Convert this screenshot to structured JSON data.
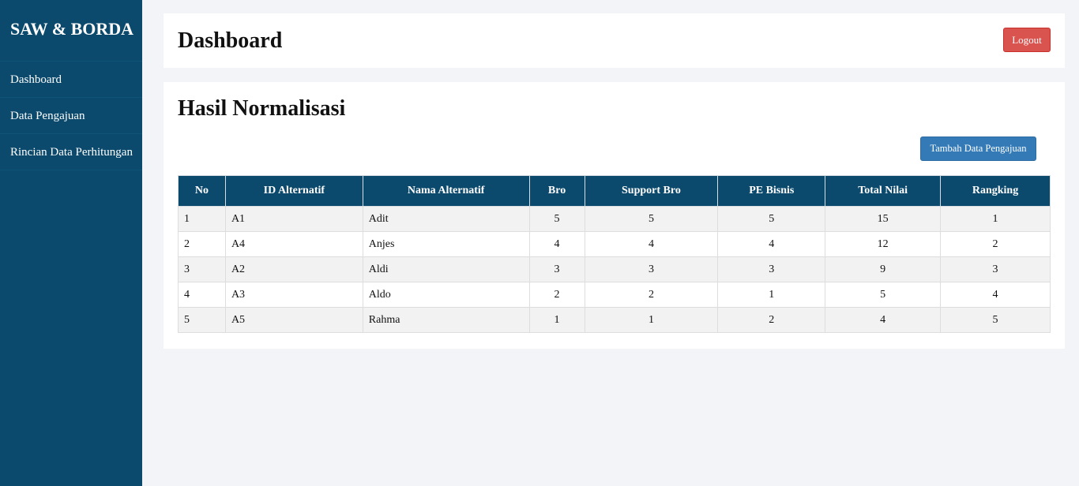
{
  "app": {
    "brand": "SAW & BORDA"
  },
  "sidebar": {
    "items": [
      {
        "label": "Dashboard"
      },
      {
        "label": "Data Pengajuan"
      },
      {
        "label": "Rincian Data Perhitungan"
      }
    ]
  },
  "header": {
    "title": "Dashboard",
    "logout_label": "Logout"
  },
  "main": {
    "title": "Hasil Normalisasi",
    "add_button_label": "Tambah Data Pengajuan",
    "table": {
      "columns": [
        "No",
        "ID Alternatif",
        "Nama Alternatif",
        "Bro",
        "Support Bro",
        "PE Bisnis",
        "Total Nilai",
        "Rangking"
      ],
      "rows": [
        [
          "1",
          "A1",
          "Adit",
          "5",
          "5",
          "5",
          "15",
          "1"
        ],
        [
          "2",
          "A4",
          "Anjes",
          "4",
          "4",
          "4",
          "12",
          "2"
        ],
        [
          "3",
          "A2",
          "Aldi",
          "3",
          "3",
          "3",
          "9",
          "3"
        ],
        [
          "4",
          "A3",
          "Aldo",
          "2",
          "2",
          "1",
          "5",
          "4"
        ],
        [
          "5",
          "A5",
          "Rahma",
          "1",
          "1",
          "2",
          "4",
          "5"
        ]
      ]
    }
  },
  "colors": {
    "sidebar_bg": "#0b4a6d",
    "table_header_bg": "#0b4a6d",
    "logout_bg": "#d9534f",
    "primary_btn_bg": "#337ab7",
    "page_bg": "#f3f4f7"
  }
}
